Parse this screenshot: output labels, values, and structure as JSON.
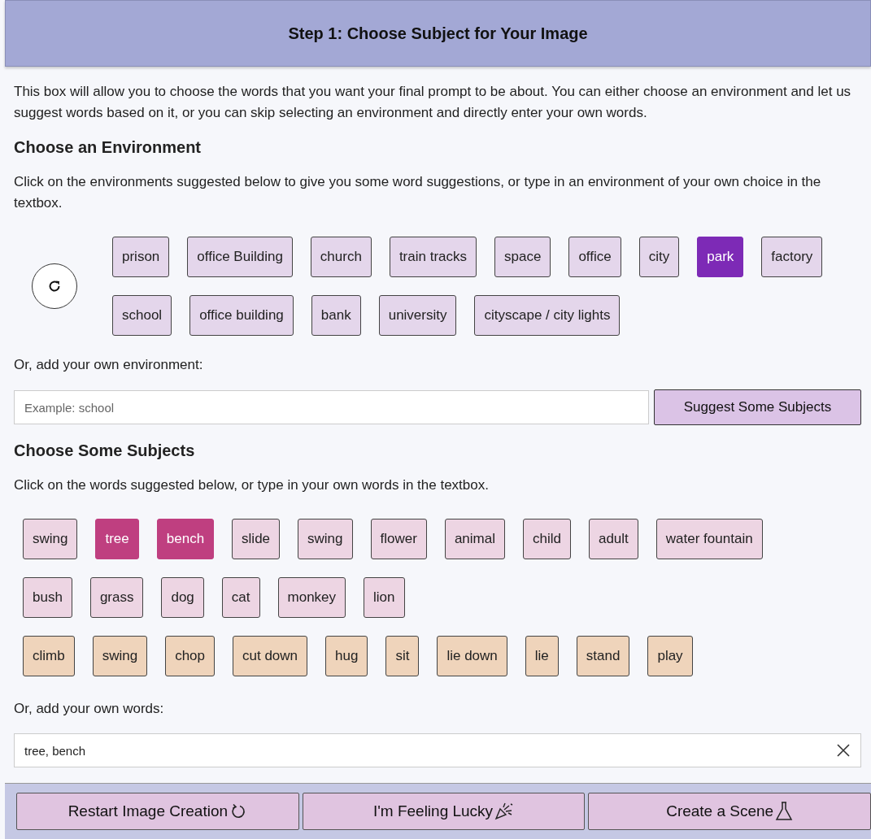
{
  "header": {
    "title": "Step 1: Choose Subject for Your Image"
  },
  "intro": "This box will allow you to choose the words that you want your final prompt to be about. You can either choose an environment and let us suggest words based on it, or you can skip selecting an environment and directly enter your own words.",
  "environment": {
    "heading": "Choose an Environment",
    "description": "Click on the environments suggested below to give you some word suggestions, or type in an environment of your own choice in the textbox.",
    "options": [
      {
        "label": "prison",
        "selected": false
      },
      {
        "label": "office Building",
        "selected": false
      },
      {
        "label": "church",
        "selected": false
      },
      {
        "label": "train tracks",
        "selected": false
      },
      {
        "label": "space",
        "selected": false
      },
      {
        "label": "office",
        "selected": false
      },
      {
        "label": "city",
        "selected": false
      },
      {
        "label": "park",
        "selected": true
      },
      {
        "label": "factory",
        "selected": false
      },
      {
        "label": "school",
        "selected": false
      },
      {
        "label": "office building",
        "selected": false
      },
      {
        "label": "bank",
        "selected": false
      },
      {
        "label": "university",
        "selected": false
      },
      {
        "label": "cityscape / city lights",
        "selected": false
      }
    ],
    "custom_label": "Or, add your own environment:",
    "input": {
      "placeholder": "Example: school"
    },
    "suggest_button": "Suggest Some Subjects"
  },
  "subjects": {
    "heading": "Choose Some Subjects",
    "description": "Click on the words suggested below, or type in your own words in the textbox.",
    "rows": [
      [
        {
          "label": "swing",
          "kind": "noun",
          "selected": false
        },
        {
          "label": "tree",
          "kind": "noun",
          "selected": true
        },
        {
          "label": "bench",
          "kind": "noun",
          "selected": true
        },
        {
          "label": "slide",
          "kind": "noun",
          "selected": false
        },
        {
          "label": "swing",
          "kind": "noun",
          "selected": false
        },
        {
          "label": "flower",
          "kind": "noun",
          "selected": false
        },
        {
          "label": "animal",
          "kind": "noun",
          "selected": false
        },
        {
          "label": "child",
          "kind": "noun",
          "selected": false
        },
        {
          "label": "adult",
          "kind": "noun",
          "selected": false
        },
        {
          "label": "water fountain",
          "kind": "noun",
          "selected": false
        }
      ],
      [
        {
          "label": "bush",
          "kind": "noun",
          "selected": false
        },
        {
          "label": "grass",
          "kind": "noun",
          "selected": false
        },
        {
          "label": "dog",
          "kind": "noun",
          "selected": false
        },
        {
          "label": "cat",
          "kind": "noun",
          "selected": false
        },
        {
          "label": "monkey",
          "kind": "noun",
          "selected": false
        },
        {
          "label": "lion",
          "kind": "noun",
          "selected": false
        }
      ],
      [
        {
          "label": "climb",
          "kind": "verb",
          "selected": false
        },
        {
          "label": "swing",
          "kind": "verb",
          "selected": false
        },
        {
          "label": "chop",
          "kind": "verb",
          "selected": false
        },
        {
          "label": "cut down",
          "kind": "verb",
          "selected": false
        },
        {
          "label": "hug",
          "kind": "verb",
          "selected": false
        },
        {
          "label": "sit",
          "kind": "verb",
          "selected": false
        },
        {
          "label": "lie down",
          "kind": "verb",
          "selected": false
        },
        {
          "label": "lie",
          "kind": "verb",
          "selected": false
        },
        {
          "label": "stand",
          "kind": "verb",
          "selected": false
        },
        {
          "label": "play",
          "kind": "verb",
          "selected": false
        }
      ]
    ],
    "custom_label": "Or, add your own words:",
    "input": {
      "value": "tree, bench"
    }
  },
  "footer": [
    {
      "label": "Restart Image Creation",
      "kind": "restart"
    },
    {
      "label": "I'm Feeling Lucky",
      "kind": "party"
    },
    {
      "label": "Create a Scene",
      "kind": "flask"
    }
  ]
}
